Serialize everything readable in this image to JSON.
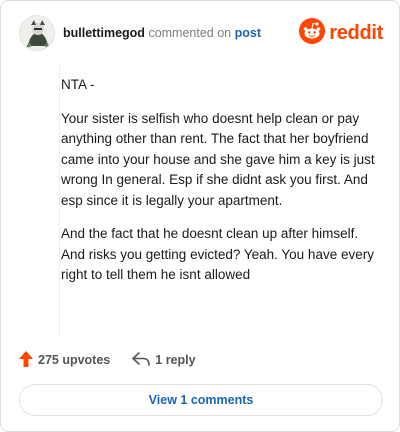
{
  "header": {
    "username": "bullettimegod",
    "verb": "commented on",
    "target": "post",
    "brand": "reddit"
  },
  "comment": {
    "paragraphs": [
      "NTA -",
      "Your sister is selfish who doesnt help clean or pay anything other than rent. The fact that her boyfriend came into your house and she gave him a key is just wrong In general. Esp if she didnt ask you first. And esp since it is legally your apartment.",
      "And the fact that he doesnt clean up after himself. And risks you getting evicted? Yeah. You have every right to tell them he isnt allowed"
    ]
  },
  "actions": {
    "upvotes": "275 upvotes",
    "replies": "1 reply"
  },
  "footer": {
    "view_label": "View 1 comments"
  },
  "colors": {
    "brand": "#ff4500",
    "link": "#1a64b4"
  },
  "icons": [
    "avatar-image",
    "reddit-logo-icon",
    "upvote-arrow-icon",
    "reply-arrow-icon"
  ]
}
